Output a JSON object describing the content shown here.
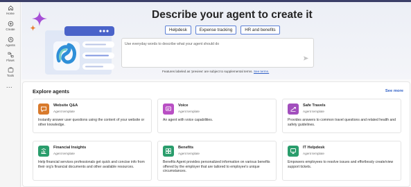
{
  "nav": {
    "items": [
      {
        "label": "Home",
        "icon": "home-icon"
      },
      {
        "label": "Create",
        "icon": "create-icon"
      },
      {
        "label": "Agents",
        "icon": "agents-icon"
      },
      {
        "label": "Flows",
        "icon": "flows-icon"
      },
      {
        "label": "Tools",
        "icon": "tools-icon"
      }
    ],
    "more": "..."
  },
  "hero": {
    "title": "Describe your agent to create it",
    "chips": [
      "Helpdesk",
      "Expense tracking",
      "HR and benefits"
    ],
    "input_placeholder": "Use everyday words to describe what your agent should do",
    "disclaimer": "Features labeled as 'preview' are subject to supplemental terms.",
    "disclaimer_link": "See terms."
  },
  "explore": {
    "title": "Explore agents",
    "see_more": "See more",
    "cards": [
      {
        "title": "Website Q&A",
        "subtitle": "Agent template",
        "description": "Instantly answer user questions using the content of your website or other knowledge.",
        "icon": "chat-bubble-icon",
        "color": "#d87a2c"
      },
      {
        "title": "Voice",
        "subtitle": "Agent template",
        "description": "An agent with voice capabilities.",
        "icon": "voice-icon",
        "color": "#b94fc4"
      },
      {
        "title": "Safe Travels",
        "subtitle": "Agent template",
        "description": "Provides answers to common travel questions and related health and safety guidelines.",
        "icon": "travel-icon",
        "color": "#a24fbd"
      },
      {
        "title": "Financial Insights",
        "subtitle": "Agent template",
        "description": "Help financial services professionals get quick and concise info from their org's financial documents and other available resources.",
        "icon": "finance-icon",
        "color": "#2a9d6c"
      },
      {
        "title": "Benefits",
        "subtitle": "Agent template",
        "description": "Benefits Agent provides personalized information on various benefits offered by the employer that are tailored to employee's unique circumstances.",
        "icon": "benefits-icon",
        "color": "#2a9d6c"
      },
      {
        "title": "IT Helpdesk",
        "subtitle": "Agent template",
        "description": "Empowers employees to resolve issues and effortlessly create/view support tickets.",
        "icon": "helpdesk-icon",
        "color": "#2a9d6c"
      }
    ]
  },
  "colors": {
    "accent": "#2f5fc5",
    "topbar": "#3b3f68"
  }
}
